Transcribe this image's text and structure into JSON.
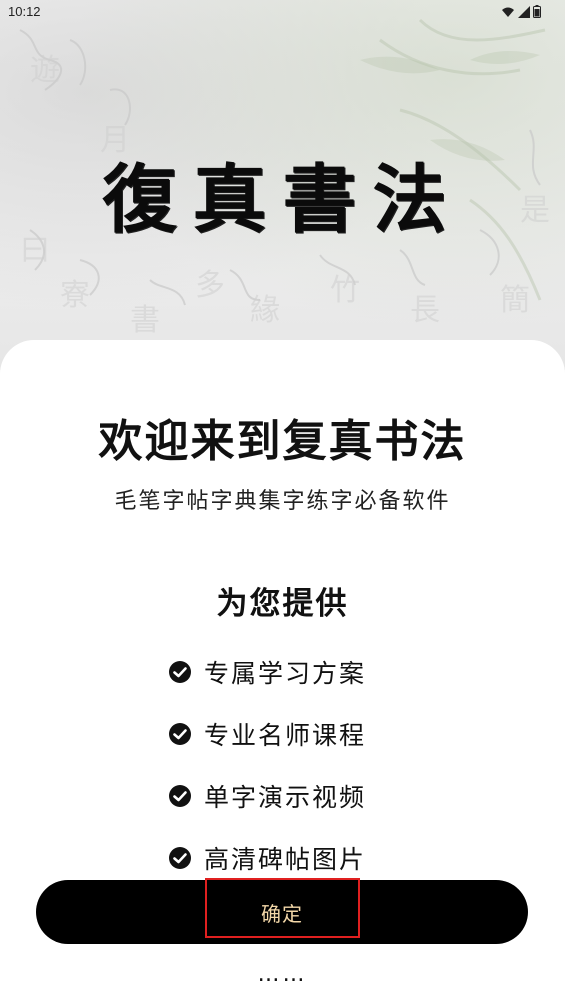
{
  "status_bar": {
    "time": "10:12",
    "icons": [
      "wifi-icon",
      "signal-icon",
      "battery-icon"
    ]
  },
  "hero": {
    "logo_text": "復真書法"
  },
  "welcome": {
    "title": "欢迎来到复真书法",
    "subtitle": "毛笔字帖字典集字练字必备软件"
  },
  "offer": {
    "title": "为您提供",
    "features": [
      "专属学习方案",
      "专业名师课程",
      "单字演示视频",
      "高清碑帖图片"
    ],
    "more": "……"
  },
  "actions": {
    "confirm_label": "确定"
  },
  "colors": {
    "button_bg": "#000000",
    "button_text": "#f3d7a8",
    "highlight": "#e02020",
    "check": "#111111"
  }
}
